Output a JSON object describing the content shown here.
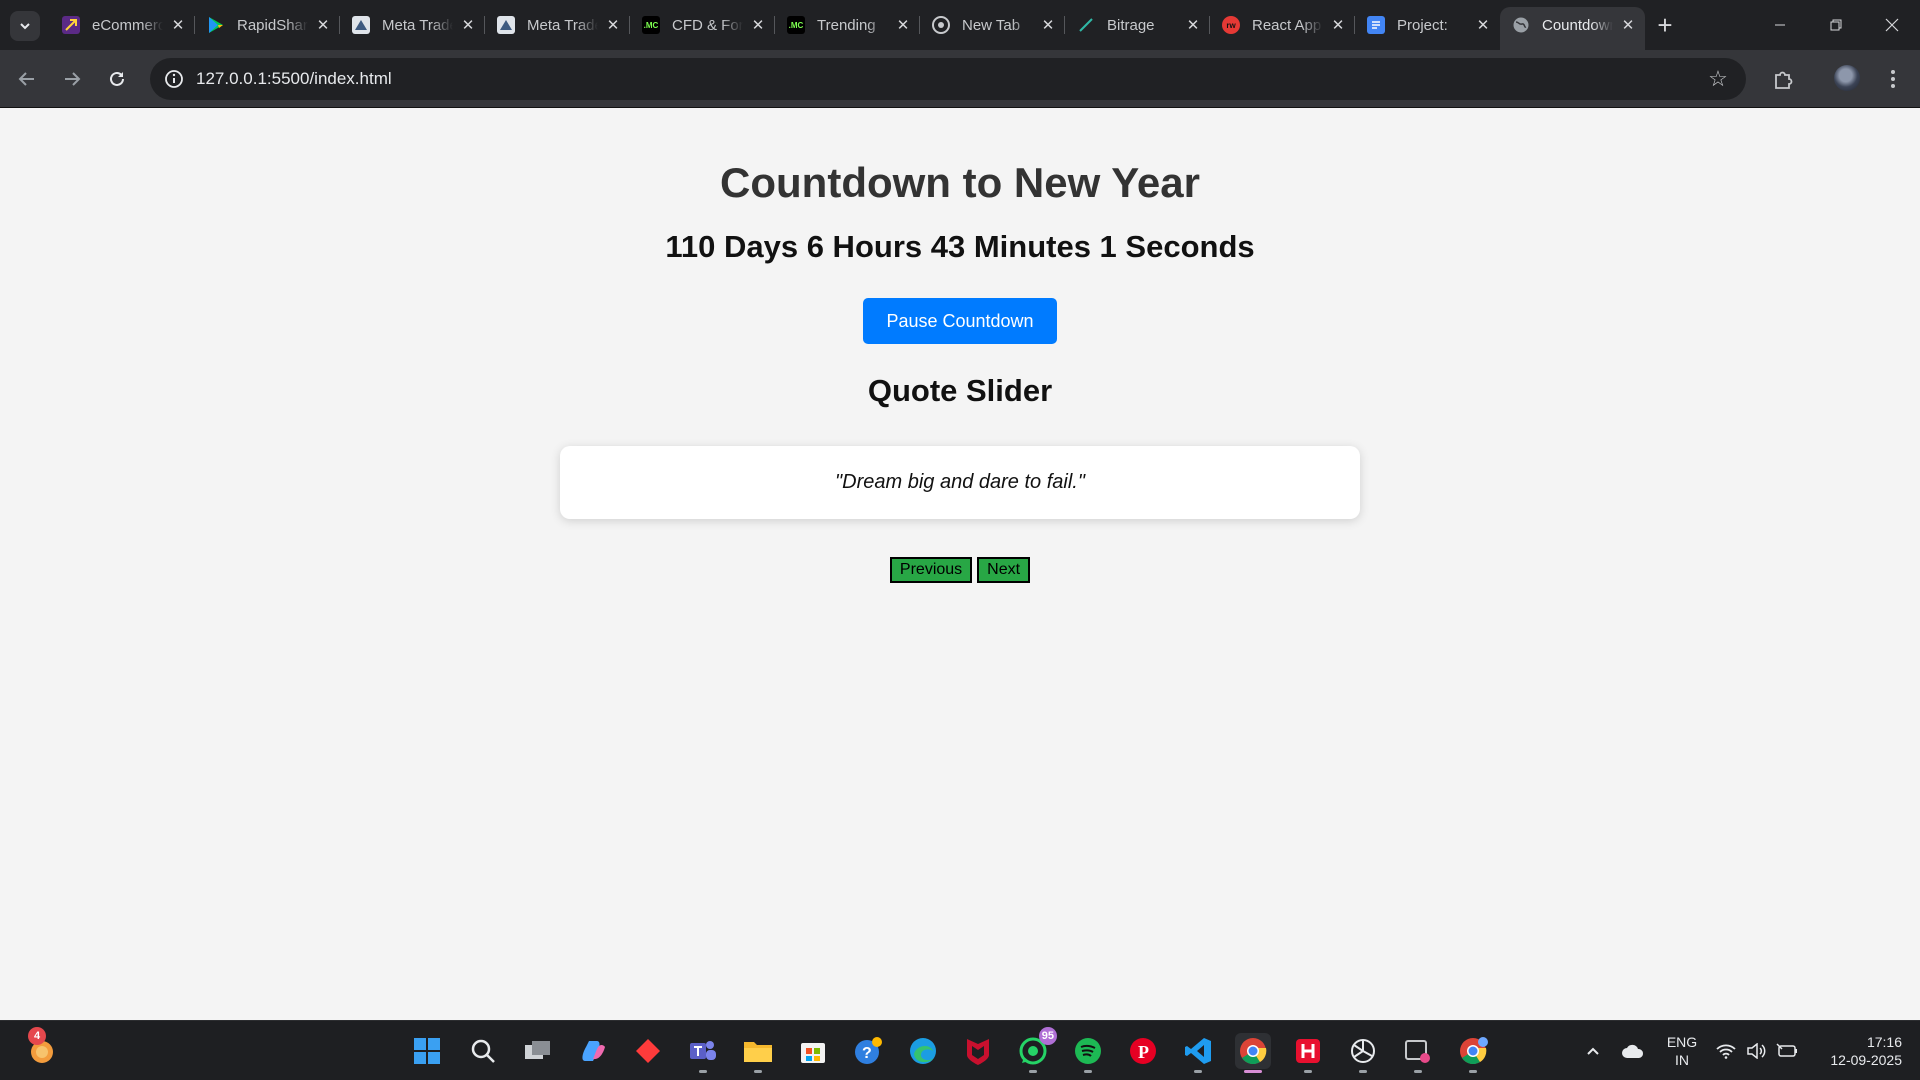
{
  "browser": {
    "tabs": [
      {
        "title": "eCommerce",
        "icon": "ecommerce-icon",
        "color": "#5b2a86"
      },
      {
        "title": "RapidShare",
        "icon": "play-store-icon",
        "color": "#00a173"
      },
      {
        "title": "Meta Trader",
        "icon": "meta-trader-icon",
        "color": "#dfe4ea"
      },
      {
        "title": "Meta Trader",
        "icon": "meta-trader-icon",
        "color": "#dfe4ea"
      },
      {
        "title": "CFD & Forex",
        "icon": "mc-icon",
        "color": "#000000"
      },
      {
        "title": "Trending",
        "icon": "mc-icon",
        "color": "#000000"
      },
      {
        "title": "New Tab",
        "icon": "chrome-icon",
        "color": "#9aa0a6"
      },
      {
        "title": "Bitrage",
        "icon": "pen-icon",
        "color": "#2fb8a6"
      },
      {
        "title": "React App",
        "icon": "react-icon",
        "color": "#e53935"
      },
      {
        "title": "Project:",
        "icon": "docs-icon",
        "color": "#4285f4"
      },
      {
        "title": "Countdown",
        "icon": "globe-icon",
        "color": "#9aa0a6",
        "active": true
      }
    ],
    "url": "127.0.0.1:5500/index.html"
  },
  "page": {
    "title": "Countdown to New Year",
    "countdown_text": "110 Days 6 Hours 43 Minutes 1 Seconds",
    "pause_button": "Pause Countdown",
    "quote_heading": "Quote Slider",
    "quote": "\"Dream big and dare to fail.\"",
    "prev_button": "Previous",
    "next_button": "Next",
    "colors": {
      "primary_button": "#007bff",
      "slider_button": "#28a745",
      "background": "#f4f4f4"
    }
  },
  "taskbar": {
    "widgets_badge": "4",
    "whatsapp_badge": "95",
    "language_line1": "ENG",
    "language_line2": "IN",
    "time": "17:16",
    "date": "12-09-2025"
  }
}
